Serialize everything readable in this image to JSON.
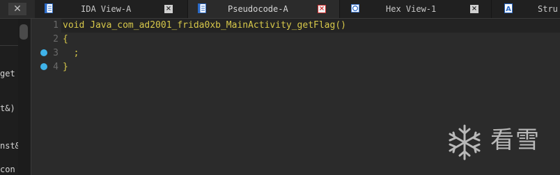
{
  "tabs": [
    {
      "label": "IDA View-A",
      "icon": "ida-view-icon",
      "active": false
    },
    {
      "label": "Pseudocode-A",
      "icon": "pseudocode-icon",
      "active": true
    },
    {
      "label": "Hex View-1",
      "icon": "hex-view-icon",
      "active": false
    },
    {
      "label": "Stru",
      "icon": "structures-icon",
      "active": false
    }
  ],
  "left_panel": {
    "fragments": [
      "get",
      "t&)",
      "nst&",
      "con"
    ]
  },
  "editor": {
    "lines": [
      {
        "number": "1",
        "text": "void Java_com_ad2001_frida0xb_MainActivity_getFlag()",
        "breakpoint": false
      },
      {
        "number": "2",
        "text": "{",
        "breakpoint": false
      },
      {
        "number": "3",
        "text": "  ;",
        "breakpoint": true
      },
      {
        "number": "4",
        "text": "}",
        "breakpoint": true
      }
    ]
  },
  "watermark": {
    "text": "看雪",
    "icon": "snowflake-icon"
  },
  "colors": {
    "code_text": "#d7c84a",
    "breakpoint": "#3fb3ea",
    "background": "#2b2b2b"
  }
}
